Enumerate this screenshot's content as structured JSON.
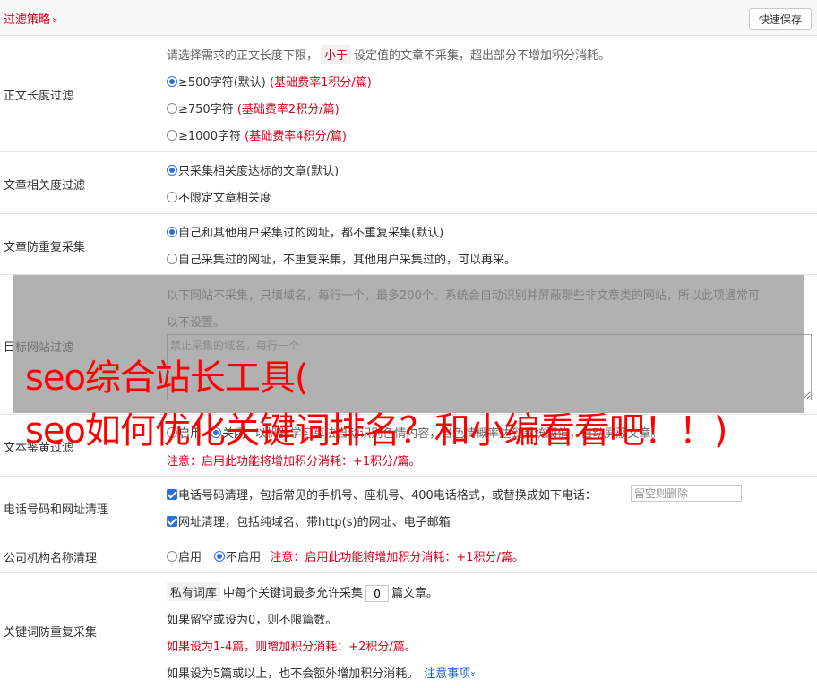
{
  "header": {
    "title": "过滤策略",
    "chevron": "»",
    "quick_save": "快速保存"
  },
  "length_filter": {
    "label": "正文长度过滤",
    "desc_a": "请选择需求的正文长度下限，",
    "desc_tag": "小于",
    "desc_b": "设定值的文章不采集，超出部分不增加积分消耗。",
    "options": [
      {
        "text": "≥500字符(默认)",
        "rate": "(基础费率1积分/篇)",
        "selected": true
      },
      {
        "text": "≥750字符",
        "rate": "(基础费率2积分/篇)",
        "selected": false
      },
      {
        "text": "≥1000字符",
        "rate": "(基础费率4积分/篇)",
        "selected": false
      }
    ]
  },
  "relevance": {
    "label": "文章相关度过滤",
    "options": [
      {
        "text": "只采集相关度达标的文章(默认)",
        "selected": true
      },
      {
        "text": "不限定文章相关度",
        "selected": false
      }
    ]
  },
  "dedup": {
    "label": "文章防重复采集",
    "options": [
      {
        "text": "自己和其他用户采集过的网址，都不重复采集(默认)",
        "selected": true
      },
      {
        "text": "自己采集过的网址，不重复采集，其他用户采集过的，可以再采。",
        "selected": false
      }
    ]
  },
  "target_site": {
    "label": "目标网站过滤",
    "desc_line1": "以下网站不采集，只填域名，每行一个，最多200个。系统会自动识别并屏蔽那些非文章类的网站，所以此项通常可",
    "desc_line2": "以不设置。",
    "placeholder": "禁止采集的域名，每行一个"
  },
  "porn": {
    "label": "文本鉴黄过滤",
    "opt_on": "启用",
    "opt_off": "关闭",
    "desc": "以机器学习算法自动识别色情内容，当色情概率达到系统阈值，自动屏蔽文章。",
    "note": "注意：启用此功能将增加积分消耗：+1积分/篇。"
  },
  "phone_url": {
    "label": "电话号码和网址清理",
    "phone_text": "电话号码清理，包括常见的手机号、座机号、400电话格式，或替换成如下电话：",
    "phone_placeholder": "留空则删除",
    "url_text": "网址清理，包括纯域名、带http(s)的网址、电子邮箱"
  },
  "company": {
    "label": "公司机构名称清理",
    "opt_on": "启用",
    "opt_off": "不启用",
    "note": "注意：启用此功能将增加积分消耗：+1积分/篇。"
  },
  "keyword_dedup": {
    "label": "关键词防重复采集",
    "tag": "私有词库",
    "line1_a": "中每个关键词最多允许采集",
    "value": "0",
    "line1_b": "篇文章。",
    "line2": "如果留空或设为0，则不限篇数。",
    "line3": "如果设为1-4篇，则增加积分消耗：+2积分/篇。",
    "line4": "如果设为5篇或以上，也不会额外增加积分消耗。",
    "link": "注意事项",
    "link_chevron": "»"
  },
  "overlay": {
    "line1": "seo综合站长工具(",
    "line2": "seo如何优化关键词排名？和小编看看吧！！)"
  }
}
